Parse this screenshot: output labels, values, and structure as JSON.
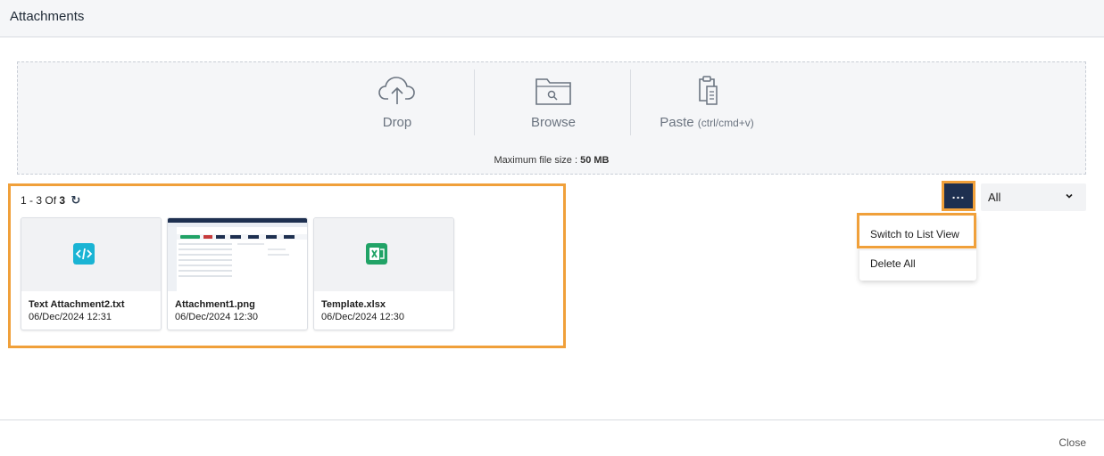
{
  "header": {
    "title": "Attachments"
  },
  "dropzone": {
    "drop_label": "Drop",
    "browse_label": "Browse",
    "paste_label": "Paste",
    "paste_hint": "(ctrl/cmd+v)",
    "max_size_label": "Maximum file size :",
    "max_size_value": "50 MB"
  },
  "pager": {
    "range": "1 - 3",
    "of_label": "Of",
    "total": "3"
  },
  "attachments": [
    {
      "name": "Text Attachment2.txt",
      "date": "06/Dec/2024 12:31",
      "icon": "code-file-icon",
      "color": "#1ab4d4"
    },
    {
      "name": "Attachment1.png",
      "date": "06/Dec/2024 12:30",
      "icon": "image-thumbnail"
    },
    {
      "name": "Template.xlsx",
      "date": "06/Dec/2024 12:30",
      "icon": "excel-icon",
      "color": "#21a366"
    }
  ],
  "toolbar": {
    "more_label": "...",
    "filter_value": "All"
  },
  "menu": {
    "items": [
      "Switch to List View",
      "Delete All"
    ]
  },
  "footer": {
    "close_label": "Close"
  },
  "colors": {
    "highlight": "#f0a03a",
    "button": "#1e3050"
  }
}
